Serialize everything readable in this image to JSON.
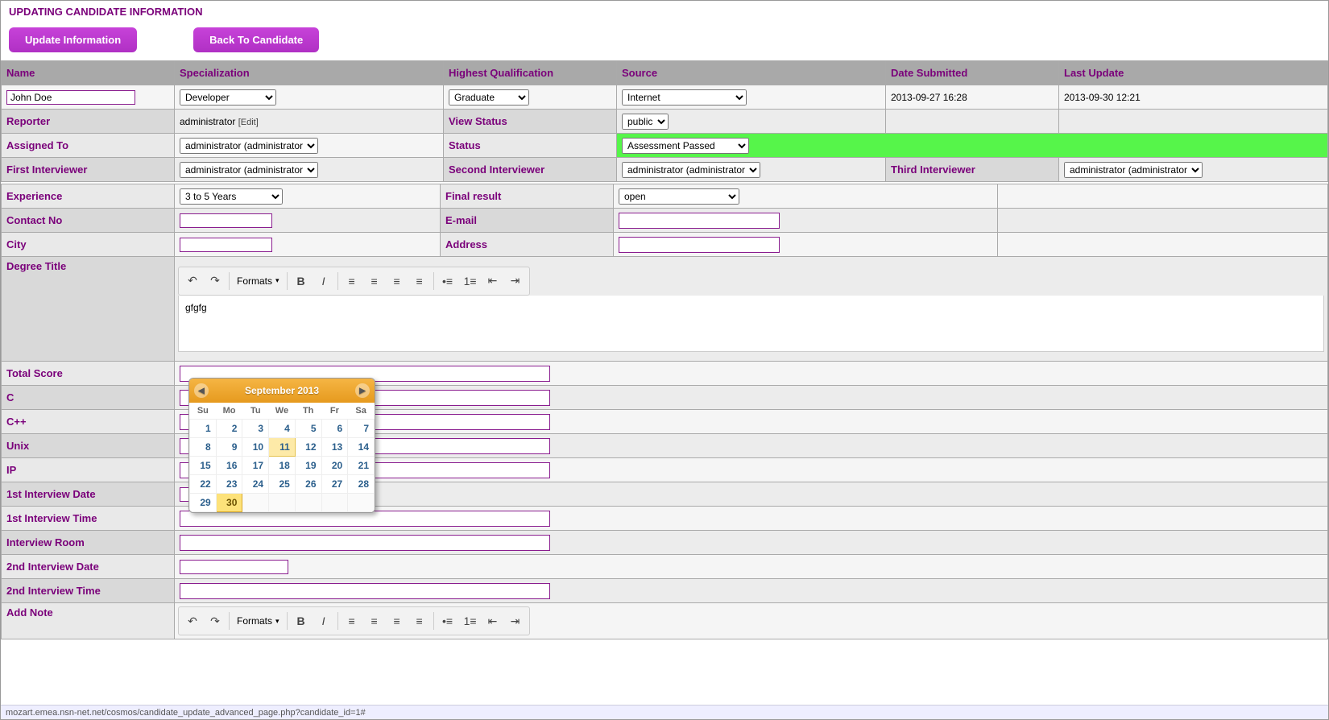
{
  "header": {
    "title": "UPDATING CANDIDATE INFORMATION"
  },
  "buttons": {
    "update": "Update Information",
    "back": "Back To Candidate"
  },
  "cols": {
    "name": "Name",
    "spec": "Specialization",
    "qual": "Highest Qualification",
    "source": "Source",
    "submitted": "Date Submitted",
    "updated": "Last Update"
  },
  "row1": {
    "name": "John Doe",
    "spec": "Developer",
    "qual": "Graduate",
    "source": "Internet",
    "submitted": "2013-09-27 16:28",
    "updated": "2013-09-30 12:21"
  },
  "labels": {
    "reporter": "Reporter",
    "viewstatus": "View Status",
    "assigned": "Assigned To",
    "status": "Status",
    "first_int": "First Interviewer",
    "second_int": "Second Interviewer",
    "third_int": "Third Interviewer",
    "exp": "Experience",
    "final": "Final result",
    "contact": "Contact No",
    "email": "E-mail",
    "city": "City",
    "address": "Address",
    "degree": "Degree Title",
    "total": "Total Score",
    "c": "C",
    "cpp": "C++",
    "unix": "Unix",
    "ip": "IP",
    "d1": "1st Interview Date",
    "t1": "1st Interview Time",
    "room": "Interview Room",
    "d2": "2nd Interview Date",
    "t2": "2nd Interview Time",
    "note": "Add Note"
  },
  "vals": {
    "reporter": "administrator",
    "edit": "[Edit]",
    "viewstatus": "public",
    "assigned": "administrator (administrator)",
    "status": "Assessment Passed",
    "first_int": "administrator (administrator)",
    "second_int": "administrator (administrator)",
    "third_int": "administrator (administrator)",
    "exp": "3 to 5 Years",
    "final": "open",
    "degree_text": "gfgfg"
  },
  "toolbar": {
    "formats": "Formats"
  },
  "calendar": {
    "title": "September 2013",
    "dow": [
      "Su",
      "Mo",
      "Tu",
      "We",
      "Th",
      "Fr",
      "Sa"
    ],
    "weeks": [
      [
        "1",
        "2",
        "3",
        "4",
        "5",
        "6",
        "7"
      ],
      [
        "8",
        "9",
        "10",
        "11",
        "12",
        "13",
        "14"
      ],
      [
        "15",
        "16",
        "17",
        "18",
        "19",
        "20",
        "21"
      ],
      [
        "22",
        "23",
        "24",
        "25",
        "26",
        "27",
        "28"
      ],
      [
        "29",
        "30",
        "",
        "",
        "",
        "",
        ""
      ]
    ],
    "highlight": "11",
    "today": "30"
  },
  "status_url": "mozart.emea.nsn-net.net/cosmos/candidate_update_advanced_page.php?candidate_id=1#"
}
